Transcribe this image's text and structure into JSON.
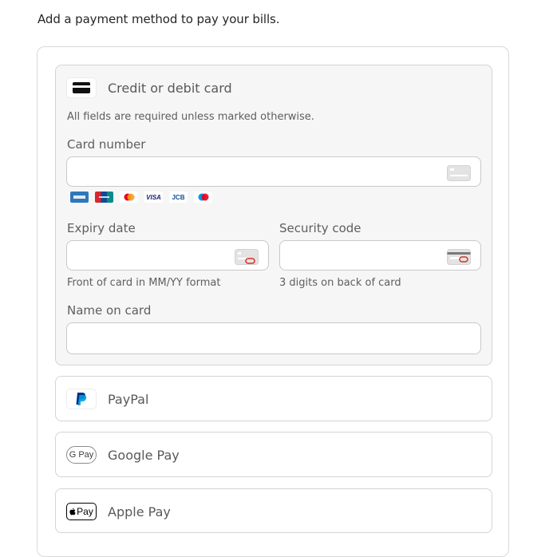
{
  "intro": "Add a payment method to pay your bills.",
  "card": {
    "title": "Credit or debit card",
    "hint": "All fields are required unless marked otherwise.",
    "card_number_label": "Card number",
    "card_number_value": "",
    "brands": [
      "amex-icon",
      "unionpay-icon",
      "mastercard-icon",
      "visa-icon",
      "jcb-icon",
      "maestro-icon"
    ],
    "visa_text": "VISA",
    "jcb_text": "JCB",
    "expiry_label": "Expiry date",
    "expiry_help": "Front of card in MM/YY format",
    "security_label": "Security code",
    "security_help": "3 digits on back of card",
    "name_label": "Name on card"
  },
  "methods": [
    {
      "label": "PayPal",
      "icon": "paypal-icon"
    },
    {
      "label": "Google Pay",
      "icon": "google-pay-icon",
      "badge": "G Pay"
    },
    {
      "label": "Apple Pay",
      "icon": "apple-pay-icon",
      "badge": "Pay"
    }
  ],
  "colors": {
    "accent_red": "#d93025",
    "border": "#d4d4d4",
    "panel_bg": "#f6f6f6",
    "paypal_dark": "#003087",
    "paypal_light": "#009cde"
  }
}
